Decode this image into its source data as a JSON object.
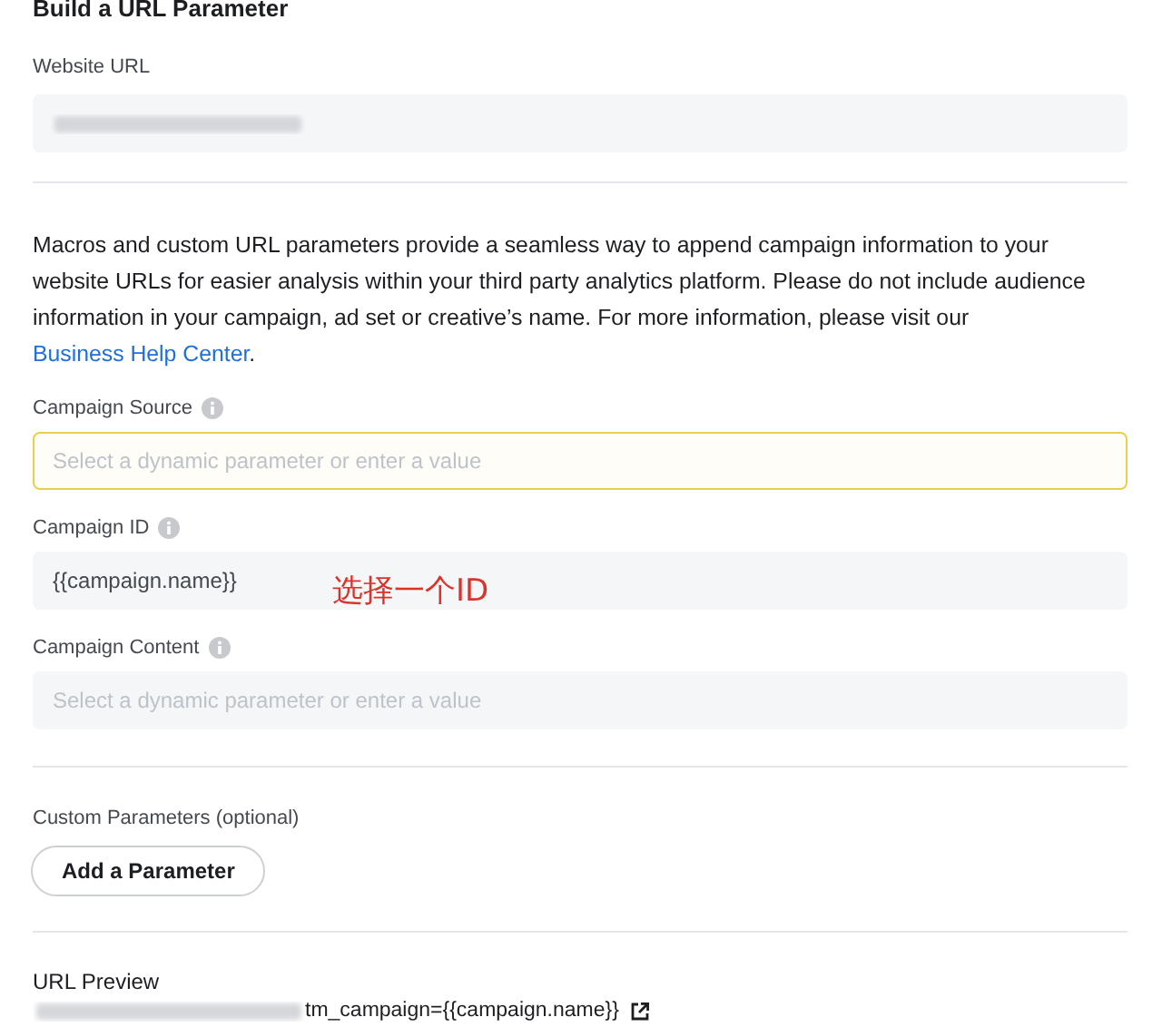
{
  "title": "Build a URL Parameter",
  "website_url": {
    "label": "Website URL",
    "redacted": true
  },
  "description": {
    "text": "Macros and custom URL parameters provide a seamless way to append campaign information to your website URLs for easier analysis within your third party analytics platform. Please do not include audience information in your campaign, ad set or creative’s name. For more information, please visit our ",
    "link": "Business Help Center",
    "after": "."
  },
  "fields": [
    {
      "label": "Campaign Source",
      "info": true,
      "placeholder": "Select a dynamic parameter or enter a value",
      "focused": true
    },
    {
      "label": "Campaign ID",
      "info": true,
      "value": "{{campaign.name}}",
      "focused": false,
      "annotation": {
        "text": "选择一个ID",
        "color": "#d9342b"
      }
    },
    {
      "label": "Campaign Content",
      "info": true,
      "placeholder": "Select a dynamic parameter or enter a value",
      "focused": false
    }
  ],
  "custom_parameters": {
    "label": "Custom Parameters (optional)",
    "button": "Add a Parameter"
  },
  "url_preview": {
    "label": "URL Preview",
    "redacted": true,
    "value": "tm_campaign={{campaign.name}}"
  }
}
